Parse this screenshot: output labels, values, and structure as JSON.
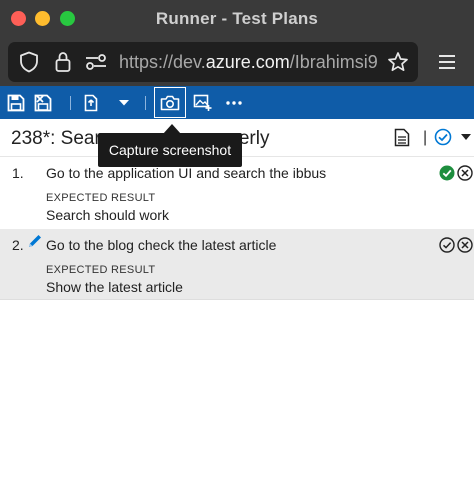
{
  "window": {
    "title": "Runner - Test Plans"
  },
  "urlbar": {
    "url_prefix": "https://dev.",
    "url_domain": "azure.com",
    "url_path": "/Ibrahimsi9"
  },
  "tooltip": {
    "text": "Capture screenshot"
  },
  "header": {
    "title_left": "238*: Searc",
    "title_right": "perly",
    "separator": "|"
  },
  "steps": [
    {
      "number": "1.",
      "action": "Go to the application UI and search the ibbus",
      "expected_label": "EXPECTED RESULT",
      "expected": "Search should work"
    },
    {
      "number": "2.",
      "action": "Go to the blog check the latest article",
      "expected_label": "EXPECTED RESULT",
      "expected": "Show the latest article"
    }
  ],
  "colors": {
    "toolbar": "#0f5ca8",
    "pass": "#1e8e3e",
    "accent": "#0078d4"
  }
}
